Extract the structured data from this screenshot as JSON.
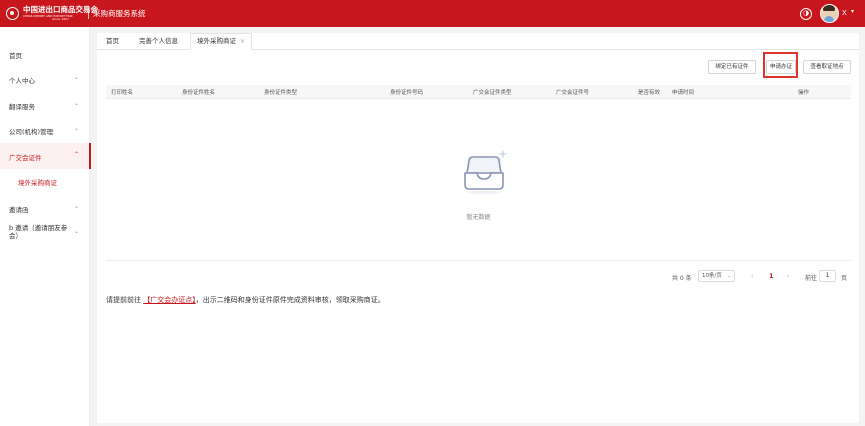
{
  "colors": {
    "brand": "#c8161d",
    "highlight_box": "#e0332c",
    "active_bg": "#fdf0f0"
  },
  "header": {
    "logo_cn": "中国进出口商品交易会",
    "logo_en": "CHINA IMPORT AND EXPORT FAIR",
    "logo_since": "Since 1957",
    "system_title": "采购商服务系统",
    "user_name": "X",
    "icons": [
      "theme-icon",
      "chevron-down-icon"
    ]
  },
  "sidebar": {
    "items": [
      {
        "label": "首页"
      },
      {
        "label": "个人中心",
        "icon": "chevron-down-icon"
      },
      {
        "label": "翻译服务",
        "icon": "chevron-down-icon"
      },
      {
        "label": "公司(机构)管理",
        "icon": "chevron-down-icon"
      },
      {
        "label": "广交会证件",
        "icon": "chevron-up-icon",
        "active": true
      },
      {
        "label": "境外采购商证",
        "sub": true
      },
      {
        "label": "邀请函",
        "icon": "chevron-down-icon"
      },
      {
        "label": "b 邀请（邀请朋友参会）",
        "icon": "chevron-down-icon"
      }
    ]
  },
  "tabs": [
    {
      "label": "首页"
    },
    {
      "label": "完善个人信息"
    },
    {
      "label": "境外采购商证",
      "active": true,
      "close": "×"
    }
  ],
  "toolbar": {
    "bind_cert": "绑定已有证件",
    "apply_cert": "申请办证",
    "view_points": "查看取证地点"
  },
  "table": {
    "columns": [
      "打印姓名",
      "身份证件姓名",
      "身份证件类型",
      "身份证件号码",
      "广交会证件类型",
      "广交会证件号",
      "是否有效",
      "申请时间",
      "操作"
    ],
    "rows": [],
    "empty_text": "暂无数据"
  },
  "pagination": {
    "total": "共 0 条",
    "page_size": "10条/页",
    "prev": "‹",
    "current_page": "1",
    "next": "›",
    "goto_label": "前往",
    "goto_value": "1",
    "page_suffix": "页"
  },
  "notice": {
    "prefix": "请提前前往",
    "link": "【广交会办证点】",
    "suffix": "，出示二维码和身份证件原件完成资料审核，领取采购商证。"
  }
}
